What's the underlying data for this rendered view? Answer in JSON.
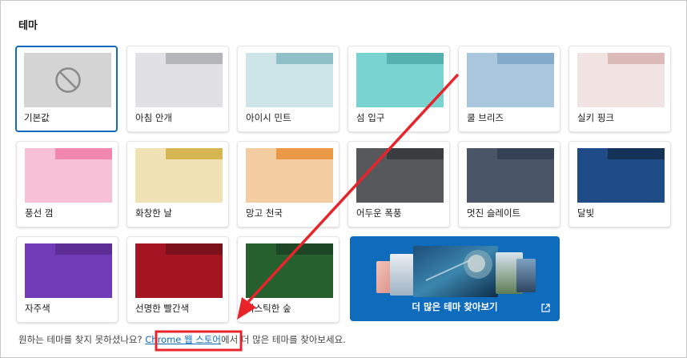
{
  "section_title": "테마",
  "themes": [
    {
      "label": "기본값",
      "selected": true,
      "icon": "blocked-icon"
    },
    {
      "label": "아침 안개",
      "tab": "#aeb0b3",
      "strip": "#b3b5b8",
      "body": "#e1e1e5"
    },
    {
      "label": "아이시 민트",
      "tab": "#87bcc3",
      "strip": "#8fc0c7",
      "body": "#cce4e7"
    },
    {
      "label": "섬 입구",
      "tab": "#47aaa9",
      "strip": "#55b1b0",
      "body": "#79d3d0"
    },
    {
      "label": "쿨 브리즈",
      "tab": "#7aa3c5",
      "strip": "#85abca",
      "body": "#a9c6dc"
    },
    {
      "label": "실키 핑크",
      "tab": "#d8b3b1",
      "strip": "#dcbab8",
      "body": "#f2e3e3"
    },
    {
      "label": "풍선 껌",
      "tab": "#f07ba6",
      "strip": "#f287ad",
      "body": "#f8c0d5"
    },
    {
      "label": "화창한 날",
      "tab": "#d1ac45",
      "strip": "#d6b553",
      "body": "#f0e2b4"
    },
    {
      "label": "망고 천국",
      "tab": "#e78d36",
      "strip": "#ea9845",
      "body": "#f4cca2"
    },
    {
      "label": "어두운 폭풍",
      "tab": "#34373a",
      "strip": "#3b3e41",
      "body": "#57585b"
    },
    {
      "label": "멋진 슬레이트",
      "tab": "#2e3b4f",
      "strip": "#354256",
      "body": "#4a5568"
    },
    {
      "label": "달빛",
      "tab": "#0e2a4f",
      "strip": "#143157",
      "body": "#1f4c86"
    },
    {
      "label": "자주색",
      "tab": "#55278b",
      "strip": "#5c2d93",
      "body": "#713ab6"
    },
    {
      "label": "선명한 빨간색",
      "tab": "#6e0d16",
      "strip": "#7a111b",
      "body": "#a31621"
    },
    {
      "label": "미스틱한 숲",
      "tab": "#173d21",
      "strip": "#1d4627",
      "body": "#26602f"
    }
  ],
  "more_themes": {
    "label": "더 많은 테마 찾아보기",
    "icon": "external-link-icon"
  },
  "footer": {
    "before": "원하는 테마를 찾지 못하셨나요? ",
    "link": "Chrome 웹 스토어",
    "after": "에서 더 많은 테마를 찾아보세요."
  },
  "colors": {
    "accent": "#0f6cbd",
    "annotation": "#e8242b"
  }
}
